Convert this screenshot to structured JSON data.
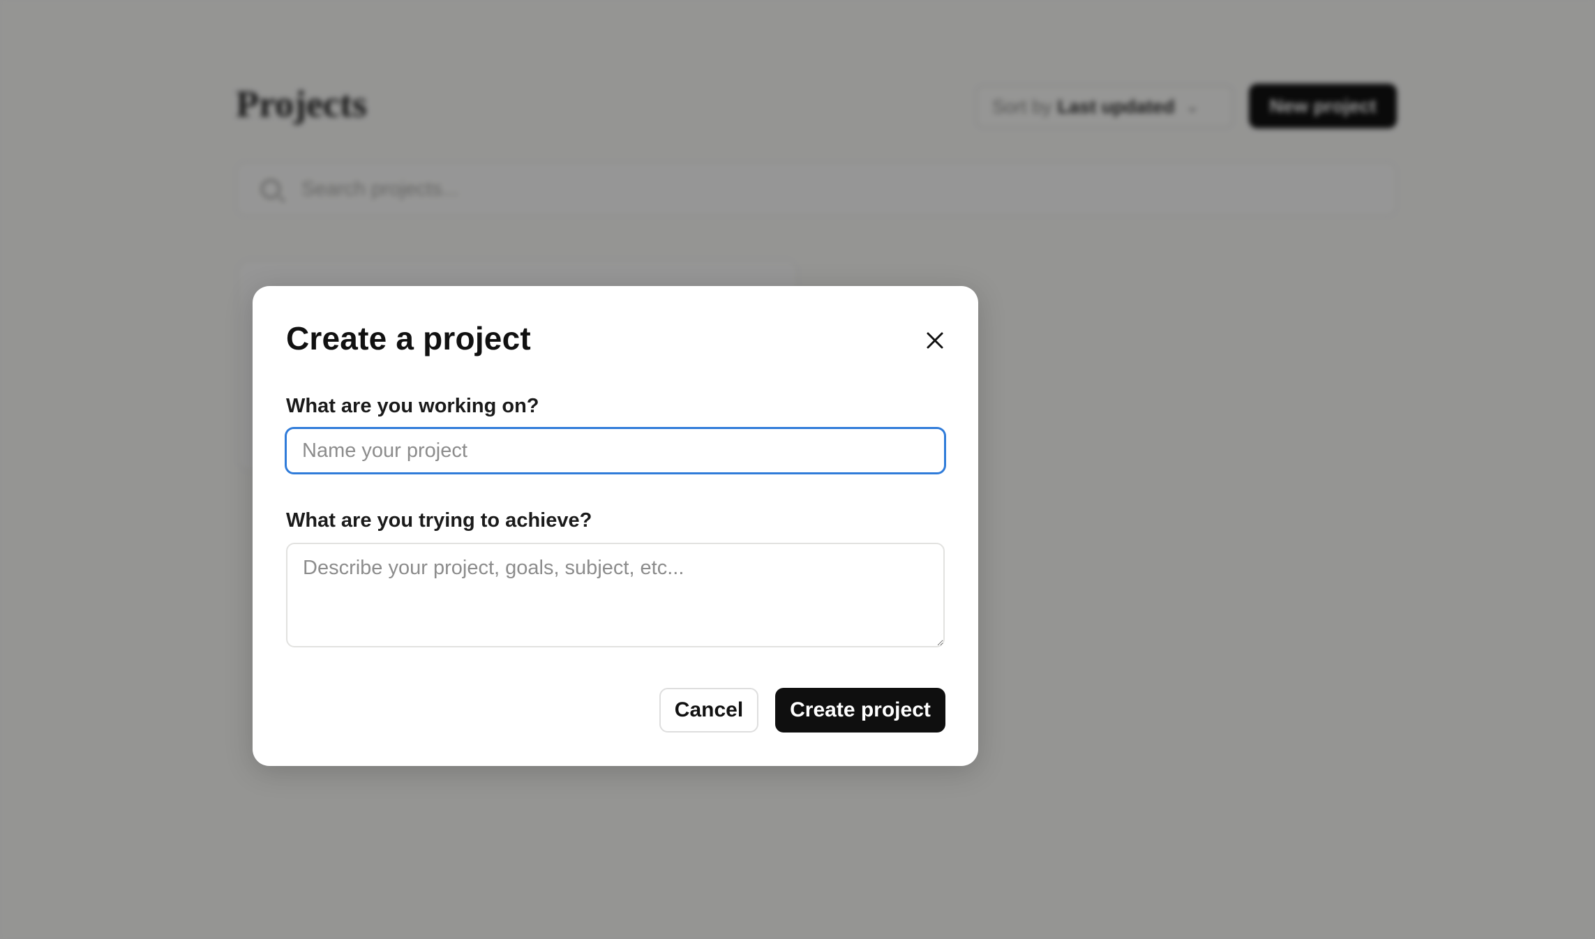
{
  "background": {
    "page_title": "Projects",
    "sort": {
      "prefix": "Sort by",
      "value": "Last updated"
    },
    "new_project_label": "New project",
    "search_placeholder": "Search projects..."
  },
  "modal": {
    "title": "Create a project",
    "close_icon": "close-icon",
    "name_field": {
      "label": "What are you working on?",
      "placeholder": "Name your project",
      "value": ""
    },
    "description_field": {
      "label": "What are you trying to achieve?",
      "placeholder": "Describe your project, goals, subject, etc...",
      "value": ""
    },
    "cancel_label": "Cancel",
    "submit_label": "Create project"
  },
  "colors": {
    "focus_ring": "#2f7bd9",
    "primary_button": "#0f0f0f",
    "overlay": "rgba(0,0,0,0.40)"
  }
}
